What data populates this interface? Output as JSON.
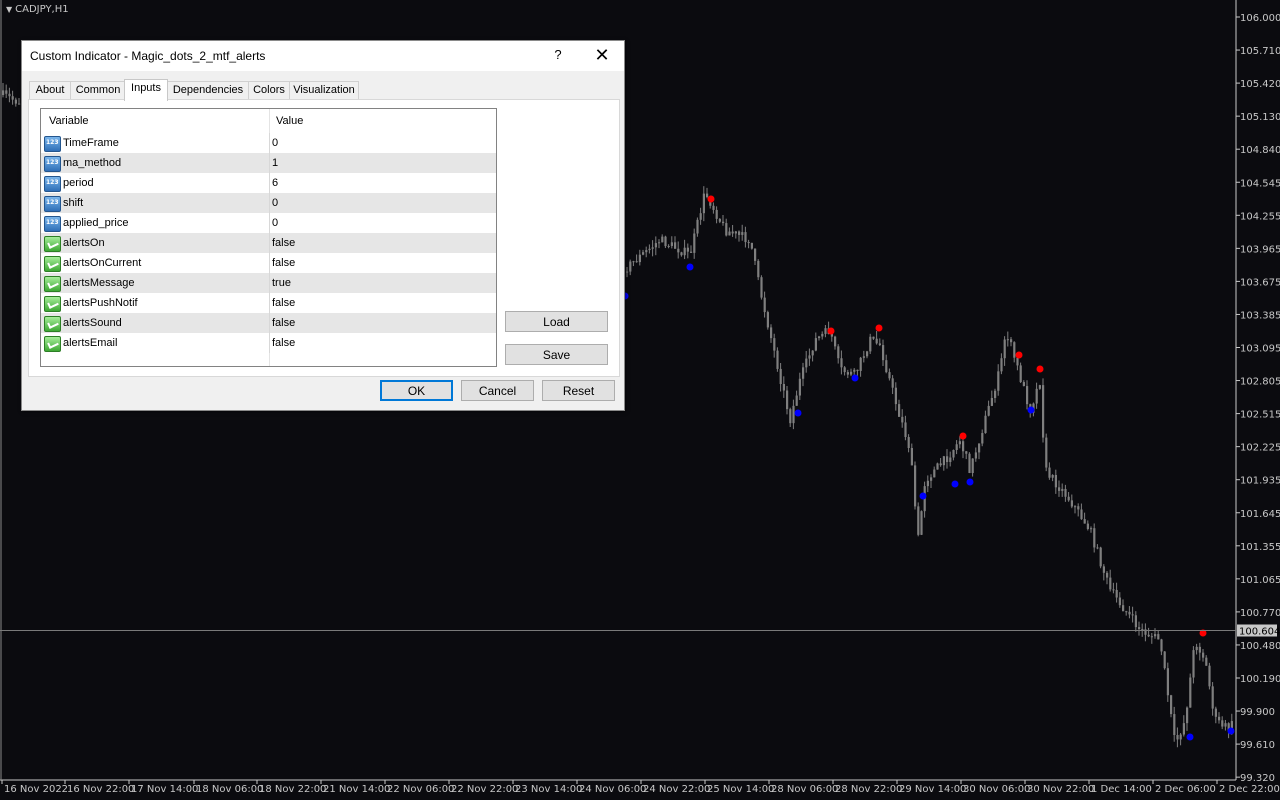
{
  "chart": {
    "symbol": "CADJPY,H1",
    "background": "#0b0b0f",
    "candle_color": "#7f7f7f",
    "marker_up_color": "#0000ff",
    "marker_down_color": "#ff0000",
    "current_price": "100.604",
    "price_labels": [
      "106.000",
      "105.710",
      "105.420",
      "105.130",
      "104.840",
      "104.545",
      "104.255",
      "103.965",
      "103.675",
      "103.385",
      "103.095",
      "102.805",
      "102.515",
      "102.225",
      "101.935",
      "101.645",
      "101.355",
      "101.065",
      "100.770",
      "100.480",
      "100.190",
      "99.900",
      "99.610",
      "99.320"
    ],
    "time_labels": [
      "16 Nov 2022",
      "16 Nov 22:00",
      "17 Nov 14:00",
      "18 Nov 06:00",
      "18 Nov 22:00",
      "21 Nov 14:00",
      "22 Nov 06:00",
      "22 Nov 22:00",
      "23 Nov 14:00",
      "24 Nov 06:00",
      "24 Nov 22:00",
      "25 Nov 14:00",
      "28 Nov 06:00",
      "28 Nov 22:00",
      "29 Nov 14:00",
      "30 Nov 06:00",
      "30 Nov 22:00",
      "1 Dec 14:00",
      "2 Dec 06:00",
      "2 Dec 22:00"
    ]
  },
  "dialog": {
    "title": "Custom Indicator - Magic_dots_2_mtf_alerts",
    "help": "?",
    "close": "✕",
    "tabs": [
      "About",
      "Common",
      "Inputs",
      "Dependencies",
      "Colors",
      "Visualization"
    ],
    "active_tab": "Inputs",
    "grid": {
      "col_variable": "Variable",
      "col_value": "Value",
      "rows": [
        {
          "icon": "number-icon",
          "variable": "TimeFrame",
          "value": "0"
        },
        {
          "icon": "number-icon",
          "variable": "ma_method",
          "value": "1"
        },
        {
          "icon": "number-icon",
          "variable": "period",
          "value": "6"
        },
        {
          "icon": "number-icon",
          "variable": "shift",
          "value": "0"
        },
        {
          "icon": "number-icon",
          "variable": "applied_price",
          "value": "0"
        },
        {
          "icon": "boolean-icon",
          "variable": "alertsOn",
          "value": "false"
        },
        {
          "icon": "boolean-icon",
          "variable": "alertsOnCurrent",
          "value": "false"
        },
        {
          "icon": "boolean-icon",
          "variable": "alertsMessage",
          "value": "true"
        },
        {
          "icon": "boolean-icon",
          "variable": "alertsPushNotif",
          "value": "false"
        },
        {
          "icon": "boolean-icon",
          "variable": "alertsSound",
          "value": "false"
        },
        {
          "icon": "boolean-icon",
          "variable": "alertsEmail",
          "value": "false"
        }
      ]
    },
    "buttons": {
      "load": "Load",
      "save": "Save",
      "ok": "OK",
      "cancel": "Cancel",
      "reset": "Reset"
    }
  }
}
